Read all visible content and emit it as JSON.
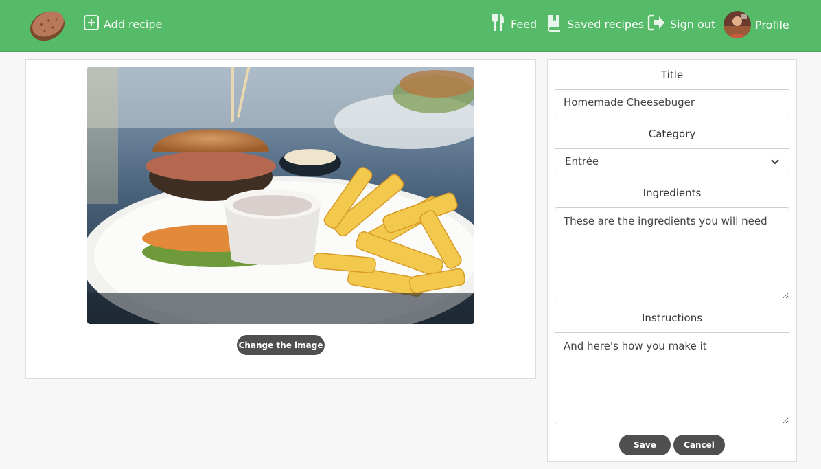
{
  "nav": {
    "add_recipe": "Add recipe",
    "feed": "Feed",
    "saved_recipes": "Saved recipes",
    "sign_out": "Sign out",
    "profile": "Profile"
  },
  "image_panel": {
    "change_image_label": "Change the image"
  },
  "form": {
    "title_label": "Title",
    "title_value": "Homemade Cheesebuger",
    "category_label": "Category",
    "category_value": "Entrée",
    "ingredients_label": "Ingredients",
    "ingredients_value": "These are the ingredients you will need",
    "instructions_label": "Instructions",
    "instructions_value": "And here's how you make it",
    "save_label": "Save",
    "cancel_label": "Cancel"
  },
  "colors": {
    "navbar": "#55bb68",
    "button_dark": "#4f4f4f",
    "background": "#f7f7f7"
  },
  "icons": {
    "logo": "potato-logo-icon",
    "add": "plus-square-icon",
    "feed": "utensils-icon",
    "saved": "book-icon",
    "signout": "sign-out-icon"
  }
}
